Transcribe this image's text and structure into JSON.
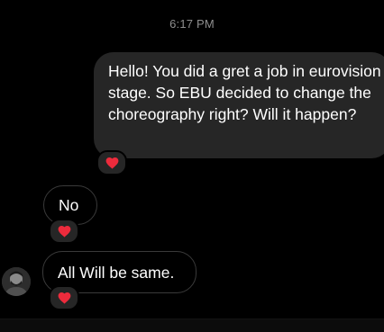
{
  "chat": {
    "timestamp": "6:17 PM",
    "messages": [
      {
        "direction": "outgoing",
        "text": "Hello! You did a gret a job in eurovision stage. So EBU decided to change the choreography right? Will it happen?",
        "reaction": "❤️"
      },
      {
        "direction": "incoming",
        "text": "No",
        "reaction": "❤️"
      },
      {
        "direction": "incoming",
        "text": "All Will be same.",
        "reaction": "❤️"
      }
    ]
  },
  "colors": {
    "background": "#000000",
    "outgoing_bubble": "#262626",
    "incoming_border": "#3a3a3a",
    "timestamp_text": "#8e8e8e",
    "heart": "#ed2b3c"
  },
  "icons": {
    "reaction": "heart-icon",
    "avatar": "profile-avatar"
  }
}
